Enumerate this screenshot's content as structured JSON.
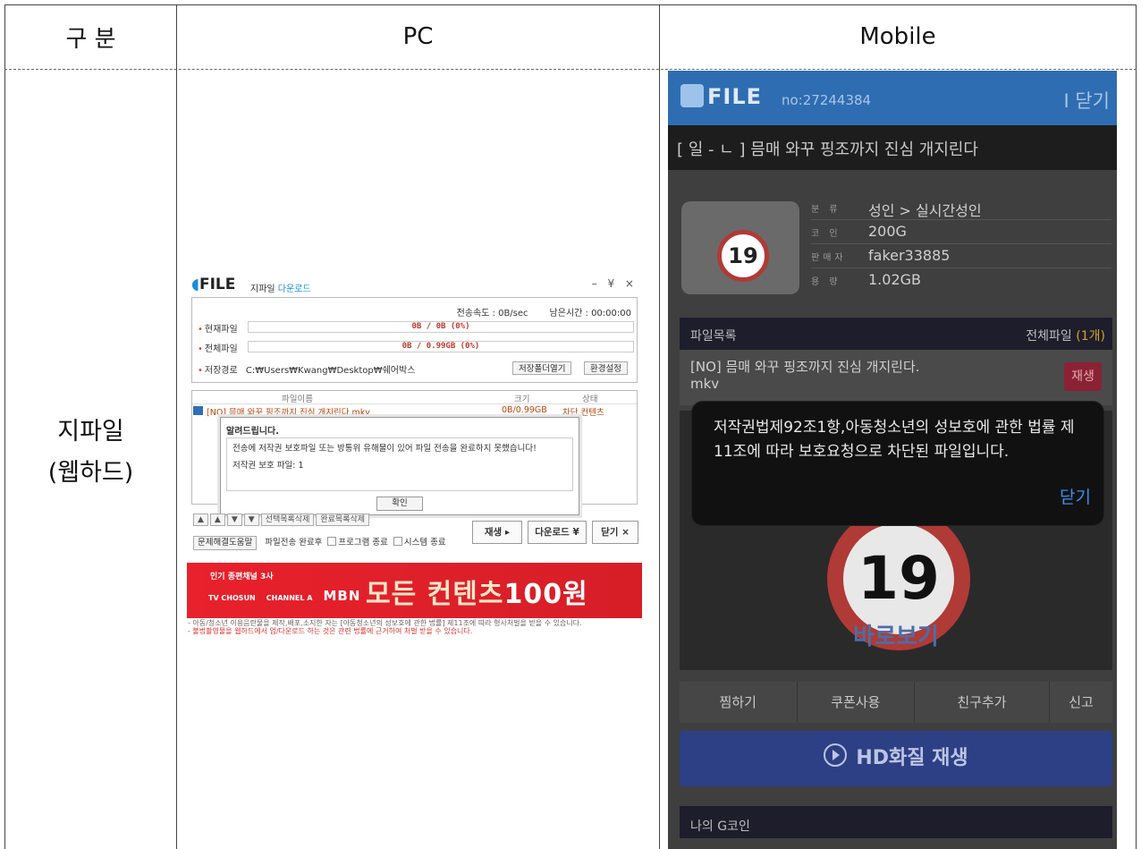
{
  "table": {
    "col1_header": "구 분",
    "col2_header": "PC",
    "col3_header": "Mobile",
    "row_label_line1": "지파일",
    "row_label_line2": "(웹하드)"
  },
  "pc": {
    "logo": "FILE",
    "window_title": "지파일",
    "window_title_accent": "다운로드",
    "window_controls": "– ¥ ×",
    "speed_label": "전송속도 : 0B/sec",
    "remaining_label": "남은시간 : 00:00:00",
    "current_file_label": "현재파일",
    "current_file_progress": "0B / 0B (0%)",
    "total_file_label": "전체파일",
    "total_file_progress": "0B / 0.99GB (0%)",
    "save_path_label": "저장경로",
    "save_path": "C:₩Users₩Kwang₩Desktop₩쉐어박스",
    "open_folder_button": "저장폴더열기",
    "settings_button": "환경설정",
    "list_headers": {
      "name": "파일이름",
      "size": "크기",
      "status": "상태"
    },
    "file_row": {
      "name": "[NO] 믐매 와꾸 핑조까지 진심 개지린다.mkv",
      "size": "0B/0.99GB",
      "status": "차단 컨텐츠"
    },
    "alert": {
      "title": "알려드립니다.",
      "message": "전송에 저작권 보호파일 또는 방통위 유해물이 있어 파일 전송을 완료하지 못했습니다!",
      "protected_count": "저작권 보호 파일: 1",
      "ok_button": "확인"
    },
    "ctl_buttons": [
      "▲",
      "▲",
      "▼",
      "▼",
      "선택목록삭제",
      "완료목록삭제"
    ],
    "play_button": "재생 ▸",
    "download_button": "다운로드 ¥",
    "close_button": "닫기 ×",
    "help_button": "문제해결도움말",
    "after_transfer_label": "파일전송 완료후",
    "opt_program_exit": "프로그램 종료",
    "opt_system_exit": "시스템 종료",
    "banner": {
      "small": "인기 종편채널 3사",
      "brand_tv": "TV CHOSUN",
      "brand_channel_a": "CHANNEL A",
      "brand_mbn": "MBN",
      "promo_text": "모든 컨텐츠",
      "promo_price": "100원"
    },
    "notice_line1": "- 아동/청소년 이용음란물을 제작,배포,소지한 자는 [아동청소년의 성보호에 관한 법률] 제11조에 따라 형사처벌을 받을 수 있습니다.",
    "notice_line2": "- 불법촬영물을 웹하드에서 업/다운로드 하는 것은 관련 법률에 근거하여 처벌 받을 수 있습니다."
  },
  "mobile": {
    "logo": "FILE",
    "file_no": "no:27244384",
    "close_top": "I 닫기",
    "title": "[ 일 - ㄴ ] 믐매 와꾸 핑조까지 진심 개지린다",
    "thumb_badge": "19",
    "info": [
      {
        "key": "분 류",
        "value": "성인 > 실시간성인"
      },
      {
        "key": "코 인",
        "value": "200G"
      },
      {
        "key": "판매자",
        "value": "faker33885"
      },
      {
        "key": "용 량",
        "value": "1.02GB"
      }
    ],
    "file_list_label": "파일목록",
    "all_files_label": "전체파일",
    "all_files_count": "(1개)",
    "file_name": "[NO] 믐매 와꾸 핑조까지 진심 개지린다.",
    "file_ext": "mkv",
    "play_button": "재생",
    "dialog_message": "저작권법제92조1항,아동청소년의 성보호에 관한 법률 제11조에 따라 보호요청으로 차단된 파일입니다.",
    "dialog_close": "닫기",
    "preview_badge": "19",
    "direct_view": "바로보기",
    "actions": [
      "찜하기",
      "쿠폰사용",
      "친구추가",
      "신고"
    ],
    "hd_play": "HD화질 재생",
    "my_coin": "나의 G코인"
  }
}
